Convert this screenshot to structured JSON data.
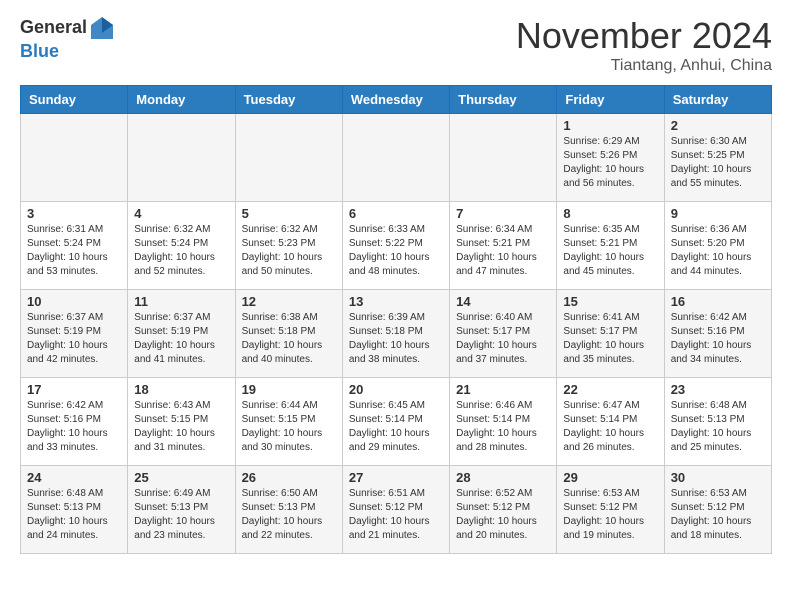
{
  "header": {
    "logo_line1": "General",
    "logo_line2": "Blue",
    "month_year": "November 2024",
    "location": "Tiantang, Anhui, China"
  },
  "days_of_week": [
    "Sunday",
    "Monday",
    "Tuesday",
    "Wednesday",
    "Thursday",
    "Friday",
    "Saturday"
  ],
  "weeks": [
    [
      {
        "day": "",
        "info": ""
      },
      {
        "day": "",
        "info": ""
      },
      {
        "day": "",
        "info": ""
      },
      {
        "day": "",
        "info": ""
      },
      {
        "day": "",
        "info": ""
      },
      {
        "day": "1",
        "info": "Sunrise: 6:29 AM\nSunset: 5:26 PM\nDaylight: 10 hours and 56 minutes."
      },
      {
        "day": "2",
        "info": "Sunrise: 6:30 AM\nSunset: 5:25 PM\nDaylight: 10 hours and 55 minutes."
      }
    ],
    [
      {
        "day": "3",
        "info": "Sunrise: 6:31 AM\nSunset: 5:24 PM\nDaylight: 10 hours and 53 minutes."
      },
      {
        "day": "4",
        "info": "Sunrise: 6:32 AM\nSunset: 5:24 PM\nDaylight: 10 hours and 52 minutes."
      },
      {
        "day": "5",
        "info": "Sunrise: 6:32 AM\nSunset: 5:23 PM\nDaylight: 10 hours and 50 minutes."
      },
      {
        "day": "6",
        "info": "Sunrise: 6:33 AM\nSunset: 5:22 PM\nDaylight: 10 hours and 48 minutes."
      },
      {
        "day": "7",
        "info": "Sunrise: 6:34 AM\nSunset: 5:21 PM\nDaylight: 10 hours and 47 minutes."
      },
      {
        "day": "8",
        "info": "Sunrise: 6:35 AM\nSunset: 5:21 PM\nDaylight: 10 hours and 45 minutes."
      },
      {
        "day": "9",
        "info": "Sunrise: 6:36 AM\nSunset: 5:20 PM\nDaylight: 10 hours and 44 minutes."
      }
    ],
    [
      {
        "day": "10",
        "info": "Sunrise: 6:37 AM\nSunset: 5:19 PM\nDaylight: 10 hours and 42 minutes."
      },
      {
        "day": "11",
        "info": "Sunrise: 6:37 AM\nSunset: 5:19 PM\nDaylight: 10 hours and 41 minutes."
      },
      {
        "day": "12",
        "info": "Sunrise: 6:38 AM\nSunset: 5:18 PM\nDaylight: 10 hours and 40 minutes."
      },
      {
        "day": "13",
        "info": "Sunrise: 6:39 AM\nSunset: 5:18 PM\nDaylight: 10 hours and 38 minutes."
      },
      {
        "day": "14",
        "info": "Sunrise: 6:40 AM\nSunset: 5:17 PM\nDaylight: 10 hours and 37 minutes."
      },
      {
        "day": "15",
        "info": "Sunrise: 6:41 AM\nSunset: 5:17 PM\nDaylight: 10 hours and 35 minutes."
      },
      {
        "day": "16",
        "info": "Sunrise: 6:42 AM\nSunset: 5:16 PM\nDaylight: 10 hours and 34 minutes."
      }
    ],
    [
      {
        "day": "17",
        "info": "Sunrise: 6:42 AM\nSunset: 5:16 PM\nDaylight: 10 hours and 33 minutes."
      },
      {
        "day": "18",
        "info": "Sunrise: 6:43 AM\nSunset: 5:15 PM\nDaylight: 10 hours and 31 minutes."
      },
      {
        "day": "19",
        "info": "Sunrise: 6:44 AM\nSunset: 5:15 PM\nDaylight: 10 hours and 30 minutes."
      },
      {
        "day": "20",
        "info": "Sunrise: 6:45 AM\nSunset: 5:14 PM\nDaylight: 10 hours and 29 minutes."
      },
      {
        "day": "21",
        "info": "Sunrise: 6:46 AM\nSunset: 5:14 PM\nDaylight: 10 hours and 28 minutes."
      },
      {
        "day": "22",
        "info": "Sunrise: 6:47 AM\nSunset: 5:14 PM\nDaylight: 10 hours and 26 minutes."
      },
      {
        "day": "23",
        "info": "Sunrise: 6:48 AM\nSunset: 5:13 PM\nDaylight: 10 hours and 25 minutes."
      }
    ],
    [
      {
        "day": "24",
        "info": "Sunrise: 6:48 AM\nSunset: 5:13 PM\nDaylight: 10 hours and 24 minutes."
      },
      {
        "day": "25",
        "info": "Sunrise: 6:49 AM\nSunset: 5:13 PM\nDaylight: 10 hours and 23 minutes."
      },
      {
        "day": "26",
        "info": "Sunrise: 6:50 AM\nSunset: 5:13 PM\nDaylight: 10 hours and 22 minutes."
      },
      {
        "day": "27",
        "info": "Sunrise: 6:51 AM\nSunset: 5:12 PM\nDaylight: 10 hours and 21 minutes."
      },
      {
        "day": "28",
        "info": "Sunrise: 6:52 AM\nSunset: 5:12 PM\nDaylight: 10 hours and 20 minutes."
      },
      {
        "day": "29",
        "info": "Sunrise: 6:53 AM\nSunset: 5:12 PM\nDaylight: 10 hours and 19 minutes."
      },
      {
        "day": "30",
        "info": "Sunrise: 6:53 AM\nSunset: 5:12 PM\nDaylight: 10 hours and 18 minutes."
      }
    ]
  ]
}
